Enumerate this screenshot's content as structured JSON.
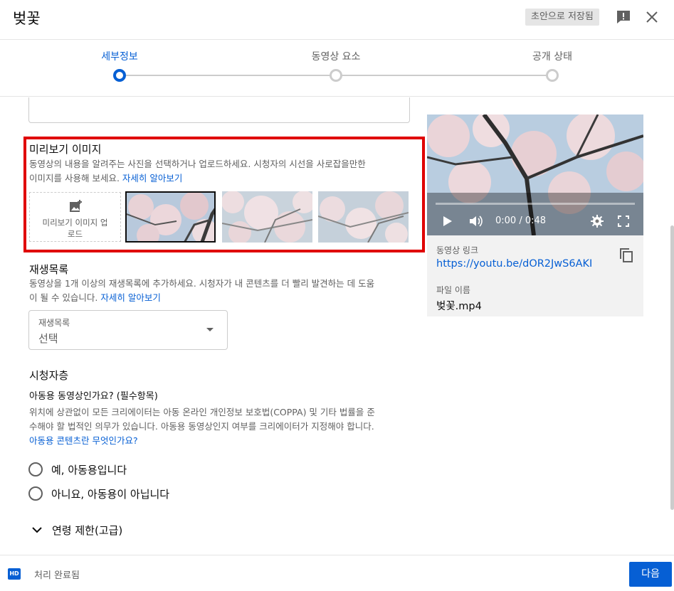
{
  "header": {
    "title": "벚꽃",
    "draft_status": "초안으로 저장됨"
  },
  "steps": [
    {
      "label": "세부정보",
      "active": true
    },
    {
      "label": "동영상 요소",
      "active": false
    },
    {
      "label": "공개 상태",
      "active": false
    }
  ],
  "thumbnail": {
    "title": "미리보기 이미지",
    "desc_line1": "동영상의 내용을 알려주는 사진을 선택하거나 업로드하세요. 시청자의 시선을 사로잡을만한",
    "desc_line2": "이미지를 사용해 보세요.",
    "learn_more": "자세히 알아보기",
    "upload_line1": "미리보기 이미지 업",
    "upload_line2": "로드"
  },
  "playlist": {
    "title": "재생목록",
    "desc_line1": "동영상을 1개 이상의 재생목록에 추가하세요. 시청자가 내 콘텐츠를 더 빨리 발견하는 데 도움",
    "desc_line2": "이 될 수 있습니다.",
    "learn_more": "자세히 알아보기",
    "select_label": "재생목록",
    "select_value": "선택"
  },
  "audience": {
    "title": "시청자층",
    "question": "아동용 동영상인가요? (필수항목)",
    "desc_line1": "위치에 상관없이 모든 크리에이터는 아동 온라인 개인정보 보호법(COPPA) 및 기타 법률을 준",
    "desc_line2": "수해야 할 법적인 의무가 있습니다. 아동용 동영상인지 여부를 크리에이터가 지정해야 합니다.",
    "help_link": "아동용 콘텐츠란 무엇인가요?",
    "option_yes": "예, 아동용입니다",
    "option_no": "아니요, 아동용이 아닙니다"
  },
  "age_restriction": {
    "label": "연령 제한(고급)"
  },
  "preview": {
    "time": "0:00 / 0:48",
    "link_label": "동영상 링크",
    "link": "https://youtu.be/dOR2JwS6AKI",
    "filename_label": "파일 이름",
    "filename": "벚꽃.mp4"
  },
  "footer": {
    "hd_badge": "HD",
    "status": "처리 완료됨",
    "next_label": "다음"
  },
  "colors": {
    "accent": "#065fd4",
    "highlight_border": "#e00000"
  }
}
